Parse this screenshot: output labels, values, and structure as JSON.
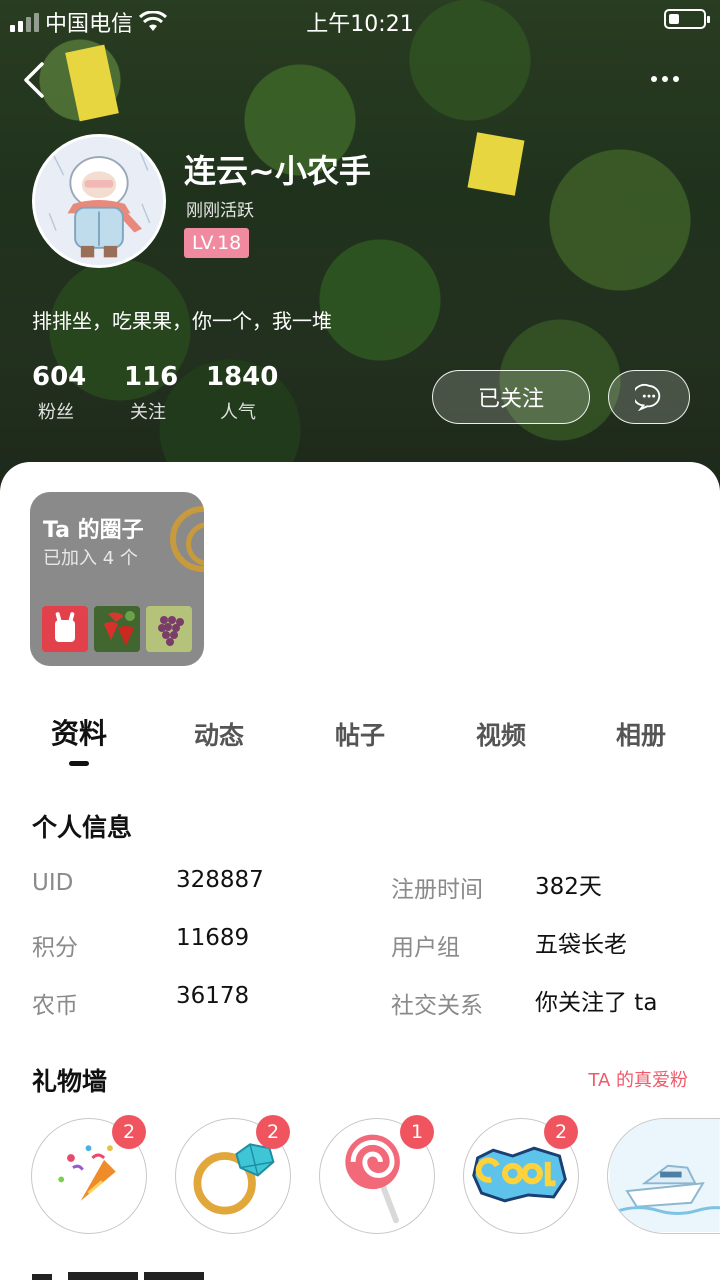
{
  "status_bar": {
    "carrier": "中国电信",
    "time": "上午10:21"
  },
  "profile": {
    "name": "连云~小农手",
    "status": "刚刚活跃",
    "level": "LV.18",
    "signature": "排排坐，吃果果，你一个，我一堆",
    "stats": [
      {
        "value": "604",
        "label": "粉丝"
      },
      {
        "value": "116",
        "label": "关注"
      },
      {
        "value": "1840",
        "label": "人气"
      }
    ],
    "follow_label": "已关注"
  },
  "circle_card": {
    "title": "Ta 的圈子",
    "subtitle": "已加入 4 个"
  },
  "tabs": [
    "资料",
    "动态",
    "帖子",
    "视频",
    "相册"
  ],
  "personal_info": {
    "title": "个人信息",
    "rows": [
      {
        "label": "UID",
        "value": "328887",
        "label2": "注册时间",
        "value2": "382天"
      },
      {
        "label": "积分",
        "value": "11689",
        "label2": "用户组",
        "value2": "五袋长老"
      },
      {
        "label": "农币",
        "value": "36178",
        "label2": "社交关系",
        "value2": "你关注了 ta"
      }
    ]
  },
  "gift_wall": {
    "title": "礼物墙",
    "link": "TA 的真爱粉",
    "gifts": [
      {
        "icon": "party-popper-icon",
        "count": "2"
      },
      {
        "icon": "diamond-ring-icon",
        "count": "2"
      },
      {
        "icon": "lollipop-icon",
        "count": "1"
      },
      {
        "icon": "cool-sticker-icon",
        "count": "2"
      },
      {
        "icon": "yacht-icon",
        "count": ""
      }
    ]
  },
  "colors": {
    "accent": "#f05a6a",
    "level_badge": "#f08aa0",
    "badge": "#f0555f"
  }
}
